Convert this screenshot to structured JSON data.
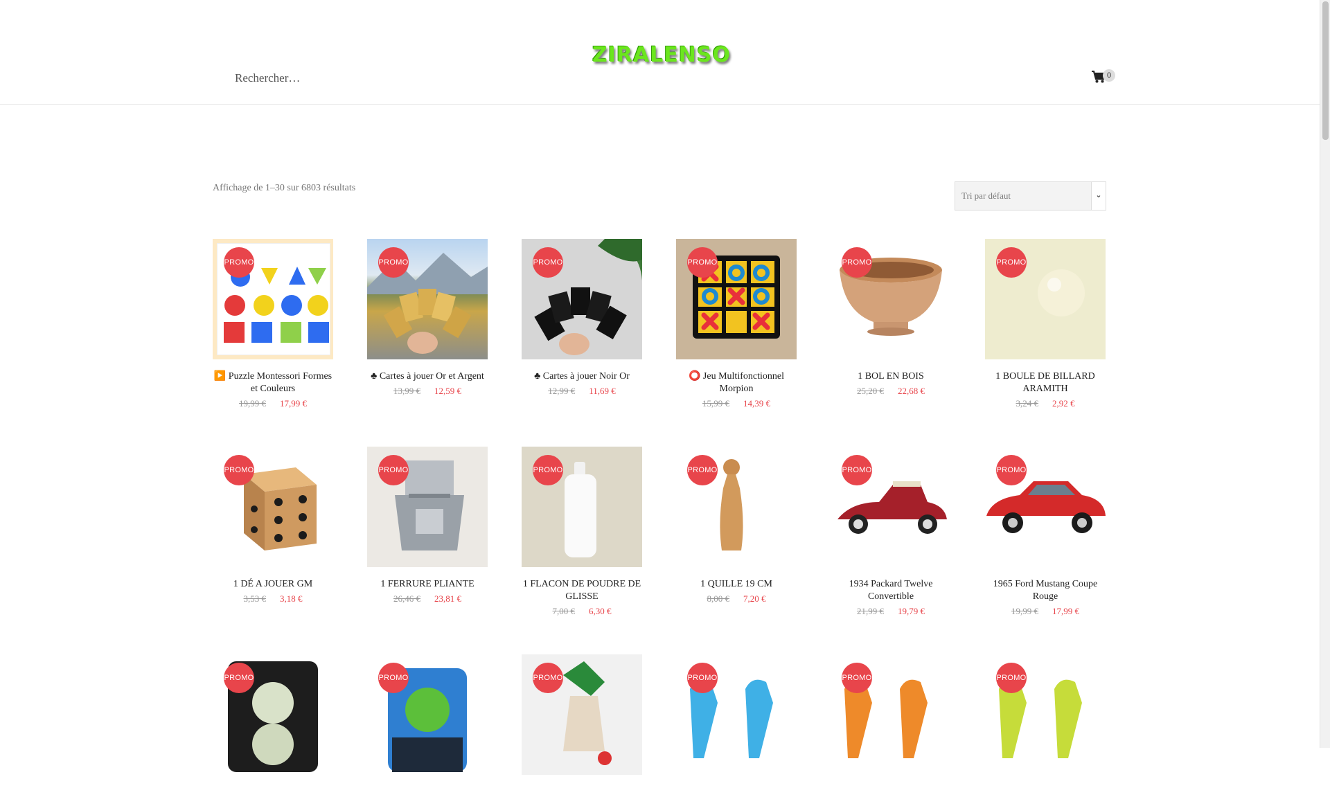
{
  "header": {
    "search_placeholder": "Rechercher…",
    "logo_text": "ZIRALENSO",
    "cart_count": "0"
  },
  "toolbar": {
    "result_count": "Affichage de 1–30 sur 6803 résultats",
    "sort_label": "Tri par défaut",
    "sort_arrow": "⌄"
  },
  "badge_label": "PROMO",
  "products": [
    {
      "title": "▶️ Puzzle Montessori Formes et Couleurs",
      "old_price": "19,99 €",
      "new_price": "17,99 €"
    },
    {
      "title": "♣ Cartes à jouer Or et Argent",
      "old_price": "13,99 €",
      "new_price": "12,59 €"
    },
    {
      "title": "♣ Cartes à jouer Noir Or",
      "old_price": "12,99 €",
      "new_price": "11,69 €"
    },
    {
      "title": "⭕ Jeu Multifonctionnel Morpion",
      "old_price": "15,99 €",
      "new_price": "14,39 €"
    },
    {
      "title": "1 BOL EN BOIS",
      "old_price": "25,20 €",
      "new_price": "22,68 €"
    },
    {
      "title": "1 BOULE DE BILLARD ARAMITH",
      "old_price": "3,24 €",
      "new_price": "2,92 €"
    },
    {
      "title": "1 DÉ A JOUER GM",
      "old_price": "3,53 €",
      "new_price": "3,18 €"
    },
    {
      "title": "1 FERRURE PLIANTE",
      "old_price": "26,46 €",
      "new_price": "23,81 €"
    },
    {
      "title": "1 FLACON DE POUDRE DE GLISSE",
      "old_price": "7,00 €",
      "new_price": "6,30 €"
    },
    {
      "title": "1 QUILLE 19 CM",
      "old_price": "8,00 €",
      "new_price": "7,20 €"
    },
    {
      "title": "1934 Packard Twelve Convertible",
      "old_price": "21,99 €",
      "new_price": "19,79 €"
    },
    {
      "title": "1965 Ford Mustang Coupe Rouge",
      "old_price": "19,99 €",
      "new_price": "17,99 €"
    },
    {
      "title": "",
      "old_price": "",
      "new_price": ""
    },
    {
      "title": "",
      "old_price": "",
      "new_price": ""
    },
    {
      "title": "",
      "old_price": "",
      "new_price": ""
    },
    {
      "title": "",
      "old_price": "",
      "new_price": ""
    },
    {
      "title": "",
      "old_price": "",
      "new_price": ""
    },
    {
      "title": "",
      "old_price": "",
      "new_price": ""
    }
  ],
  "colors": {
    "accent": "#e8454b",
    "logo": "#6be61e"
  }
}
